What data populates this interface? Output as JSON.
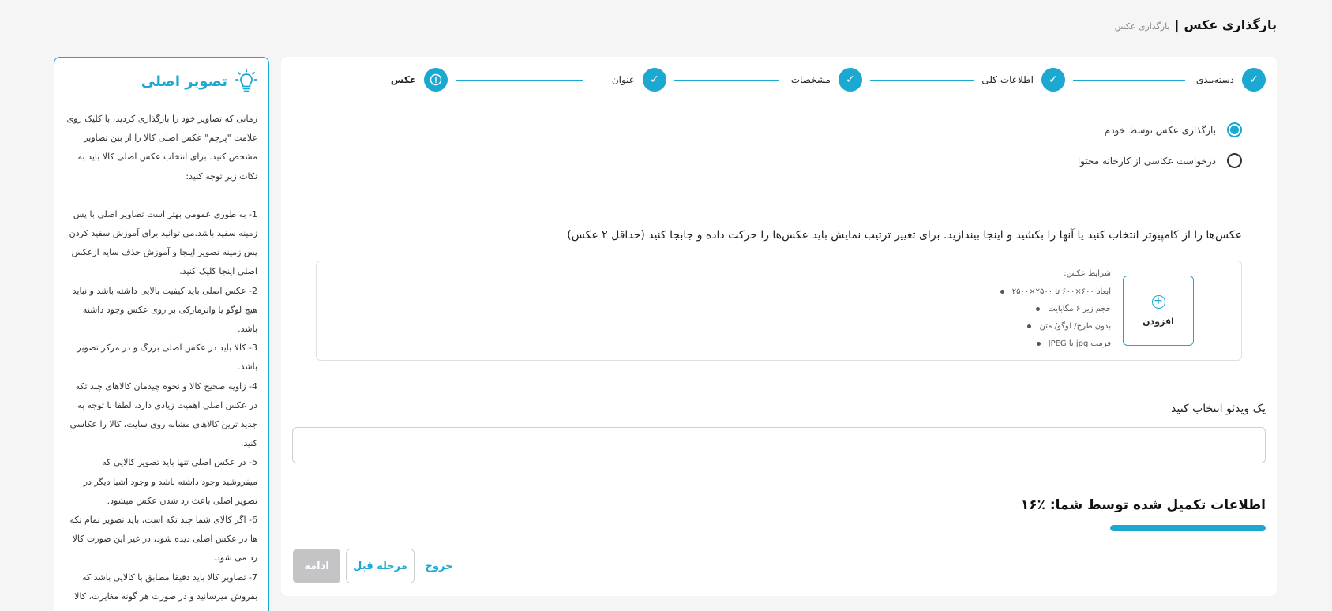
{
  "header": {
    "title": "بارگذاری عکس",
    "separator": "|",
    "breadcrumb": "بارگذاری عکس"
  },
  "stepper": {
    "steps": [
      {
        "label": "دسته‌بندی",
        "state": "done"
      },
      {
        "label": "اطلاعات کلی",
        "state": "done"
      },
      {
        "label": "مشخصات",
        "state": "done"
      },
      {
        "label": "عنوان",
        "state": "done"
      },
      {
        "label": "عکس",
        "state": "current"
      }
    ],
    "done_icon": "check-icon",
    "current_icon": "info-icon"
  },
  "photo_source": {
    "options": [
      {
        "label": "بارگذاری عکس توسط خودم",
        "checked": true
      },
      {
        "label": "درخواست عکاسی از کارخانه محتوا",
        "checked": false
      }
    ]
  },
  "upload": {
    "instruction": "عکس‌ها را از کامپیوتر انتخاب کنید یا آنها را بکشید و اینجا بیندازید. برای تغییر ترتیب نمایش باید عکس‌ها را حرکت داده و جابجا کنید (حداقل ۲ عکس)",
    "add_label": "افزودن",
    "conditions_title": "شرایط عکس:",
    "conditions": [
      "ابعاد ۶۰۰×۶۰۰ تا ۲۵۰۰×۲۵۰۰",
      "حجم زیر ۶ مگابایت",
      "بدون  طرح/ لوگو/ متن",
      "فرمت jpg یا JPEG"
    ]
  },
  "video": {
    "label": "یک ویدئو انتخاب کنید",
    "value": ""
  },
  "progress": {
    "title": "اطلاعات تکمیل شده توسط شما: ٪۱۶",
    "percent": 16
  },
  "actions": {
    "exit_label": "خروج",
    "prev_label": "مرحله قبل",
    "continue_label": "ادامه"
  },
  "side_panel": {
    "title": "تصویر اصلی",
    "icon": "lightbulb-icon",
    "intro": "زمانی که تصاویر خود را بارگذاری کردید، با کلیک روی علامت \"پرچم\" عکس اصلی کالا را از بین تصاویر مشخص کنید. برای انتخاب عکس اصلی کالا باید به نکات زیر توجه کنید:",
    "tips": [
      "1- به طوری عمومی بهتر است تصاویر اصلی با پس زمینه سفید باشد.می توانید برای آموزش سفید کردن پس زمینه تصویر اینجا و آموزش حذف سایه ازعکس اصلی اینجا کلیک کنید.",
      "2- عکس اصلی باید کیفیت بالایی داشته باشد و نباید هیچ لوگو یا واترمارکی بر روی عکس وجود داشته باشد.",
      "3- کالا باید در عکس اصلی بزرگ و در مرکز تصویر باشد.",
      "4- زاویه صحیح کالا و نحوه چیدمان کالاهای چند تکه در عکس اصلی اهمیت زیادی دارد، لطفا با توجه به جدید ترین کالاهای مشابه روی سایت، کالا را عکاسی کنید.",
      "5- در عکس اصلی تنها باید تصویر کالایی که میفروشید وجود داشته باشد و وجود اشیا دیگر در تصویر اصلی باعث رد شدن عکس میشود.",
      "6- اگر کالای شما چند تکه است، باید تصویر تمام تکه ها در عکس اصلی دیده شود، در غیر این صورت کالا رد می شود.",
      "7- تصاویر کالا باید دقیقا مطابق با کالایی باشد که بفروش میرسانید و در صورت هر گونه مغایرت، کالا"
    ]
  },
  "colors": {
    "accent": "#1ba8d1",
    "disabled": "#c4c4c6",
    "background": "#f5f5f6"
  }
}
